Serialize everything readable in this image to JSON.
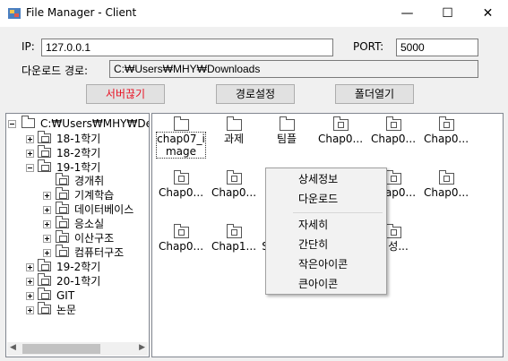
{
  "window": {
    "title": "File Manager - Client",
    "minimize": "—",
    "maximize": "☐",
    "close": "✕"
  },
  "connection": {
    "ip_label": "IP:",
    "ip_value": "127.0.0.1",
    "port_label": "PORT:",
    "port_value": "5000",
    "download_path_label": "다운로드 경로:",
    "download_path_value": "C:₩Users₩MHY₩Downloads"
  },
  "buttons": {
    "server_disconnect": "서버끊기",
    "path_settings": "경로설정",
    "open_folder": "폴더열기"
  },
  "colors": {
    "danger_text": "#e81123"
  },
  "tree": {
    "root": "C:₩Users₩MHY₩De",
    "items": [
      {
        "label": "18-1학기"
      },
      {
        "label": "18-2학기"
      },
      {
        "label": "19-1학기"
      },
      {
        "label": "경개취"
      },
      {
        "label": "기계학습"
      },
      {
        "label": "데이터베이스"
      },
      {
        "label": "응소실"
      },
      {
        "label": "이산구조"
      },
      {
        "label": "컴퓨터구조"
      },
      {
        "label": "19-2학기"
      },
      {
        "label": "20-1학기"
      },
      {
        "label": "GIT"
      },
      {
        "label": "논문"
      }
    ]
  },
  "files": [
    {
      "label1": "chap07_i",
      "label2": "mage",
      "icon": "folder-icon"
    },
    {
      "label1": "과제",
      "icon": "folder-icon"
    },
    {
      "label1": "팀플",
      "icon": "folder-icon"
    },
    {
      "label1": "Chap0...",
      "icon": "file-icon"
    },
    {
      "label1": "Chap0...",
      "icon": "file-icon"
    },
    {
      "label1": "Chap0...",
      "icon": "file-icon"
    },
    {
      "label1": "Chap0...",
      "icon": "file-icon"
    },
    {
      "label1": "Chap0...",
      "icon": "file-icon"
    },
    {
      "label1": "",
      "icon": "file-icon"
    },
    {
      "label1": "",
      "icon": "file-icon"
    },
    {
      "label1": "Chap0...",
      "icon": "file-icon"
    },
    {
      "label1": "Chap0...",
      "icon": "file-icon"
    },
    {
      "label1": "Chap0...",
      "icon": "file-icon"
    },
    {
      "label1": "Chap1...",
      "icon": "file-icon"
    },
    {
      "label1": "S",
      "icon": "file-icon"
    },
    {
      "label1": "",
      "icon": "file-icon"
    },
    {
      "label1": "현성...",
      "icon": "file-icon"
    }
  ],
  "context_menu": {
    "details": "상세정보",
    "download": "다운로드",
    "view_details": "자세히",
    "view_simple": "간단히",
    "small_icons": "작은아이콘",
    "large_icons": "큰아이콘"
  }
}
